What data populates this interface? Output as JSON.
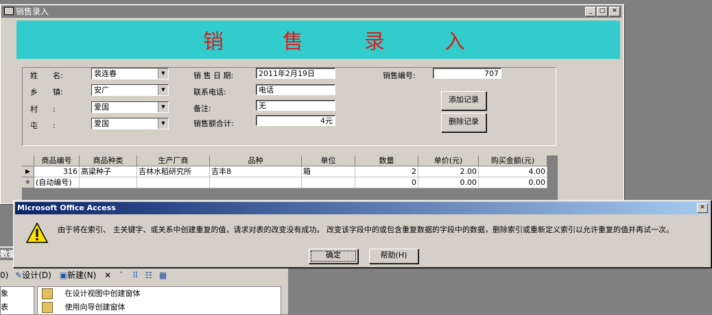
{
  "form_window": {
    "title": "销售录入",
    "banner": [
      "销",
      "售",
      "录",
      "入"
    ],
    "labels": {
      "name": "姓　　名:",
      "town": "乡　　镇:",
      "village": "村　　:",
      "hamlet": "屯　　:",
      "date": "销 售 日 期:",
      "phone": "联系电话:",
      "note": "备注:",
      "total": "销售额合计:",
      "sale_no": "销售编号:"
    },
    "values": {
      "name": "裴连春",
      "town": "安广",
      "village": "爱国",
      "hamlet": "爱国",
      "date": "2011年2月19日",
      "phone": "电话",
      "note": "无",
      "total": "4元",
      "sale_no": "707"
    },
    "buttons": {
      "add": "添加记录",
      "delete": "删除记录"
    },
    "grid": {
      "columns": [
        "商品编号",
        "商品种类",
        "生产厂商",
        "品种",
        "单位",
        "数量",
        "单价(元)",
        "购买金额(元)"
      ],
      "rows": [
        [
          "316",
          "高粱种子",
          "吉林水稻研究所",
          "吉丰8",
          "箱",
          "2",
          "2.00",
          "4.00"
        ],
        [
          "(自动编号)",
          "",
          "",
          "",
          "",
          "0",
          "0.00",
          "0.00"
        ]
      ],
      "row_markers": [
        "▶",
        "✳"
      ]
    }
  },
  "dialog": {
    "title": "Microsoft Office Access",
    "message": "由于将在索引、 主关键字、或关系中创建重复的值，请求对表的改变没有成功。 改变该字段中的或包含重复数据的字段中的数据，删除索引或重新定义索引以允许重复的值并再试一次。",
    "ok_label": "确定",
    "help_label": "帮助(H)"
  },
  "db_window": {
    "title_fragment": "数据",
    "toolbar": {
      "open_fragment": "0)",
      "design": "设计(D)",
      "new": "新建(N)"
    },
    "objects_fragment": [
      "象",
      "表"
    ],
    "items": [
      "在设计视图中创建窗体",
      "使用向导创建窗体"
    ]
  },
  "icons": [
    "form-window-icon",
    "warning-icon",
    "close-icon",
    "minimize-icon",
    "maximize-icon",
    "dropdown-arrow-icon",
    "design-icon",
    "new-icon",
    "delete-x-icon",
    "form-item-icon"
  ]
}
